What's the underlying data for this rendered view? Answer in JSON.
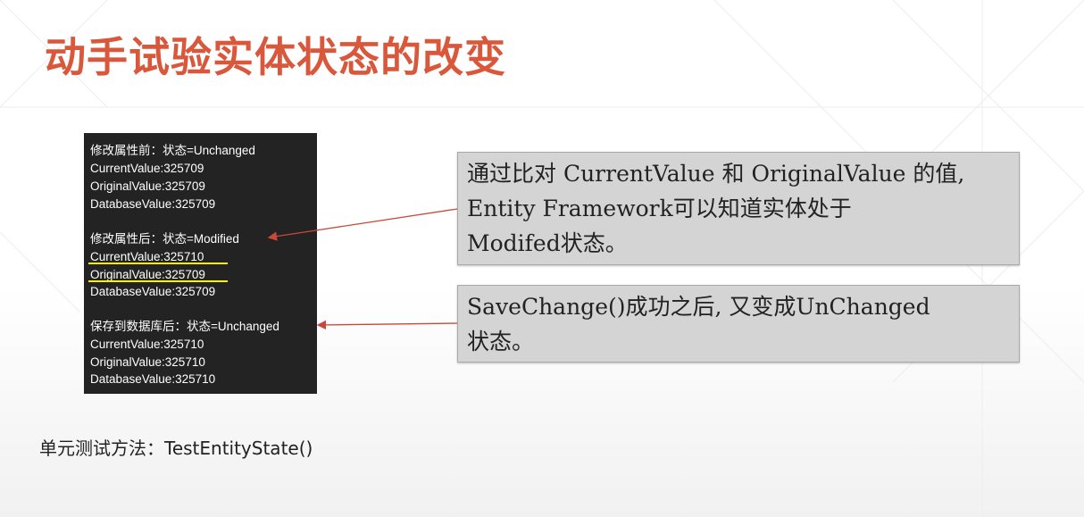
{
  "title": "动手试验实体状态的改变",
  "console": {
    "lines": [
      "修改属性前：状态=Unchanged",
      "CurrentValue:325709",
      "OriginalValue:325709",
      "DatabaseValue:325709",
      "修改属性后：状态=Modified",
      "CurrentValue:325710",
      "OriginalValue:325709",
      "DatabaseValue:325709",
      "保存到数据库后：状态=Unchanged",
      "CurrentValue:325710",
      "OriginalValue:325710",
      "DatabaseValue:325710"
    ]
  },
  "callouts": [
    {
      "lines": [
        "通过比对 CurrentValue 和 OriginalValue 的值,",
        "Entity Framework可以知道实体处于",
        "Modifed状态。"
      ]
    },
    {
      "lines": [
        "SaveChange()成功之后, 又变成UnChanged",
        "状态。"
      ]
    }
  ],
  "footer": "单元测试方法：TestEntityState()",
  "colors": {
    "title": "#d9573a",
    "highlight": "#fff200",
    "arrow": "#c8483a",
    "console_bg": "#232323",
    "callout_bg": "#d4d4d4"
  }
}
